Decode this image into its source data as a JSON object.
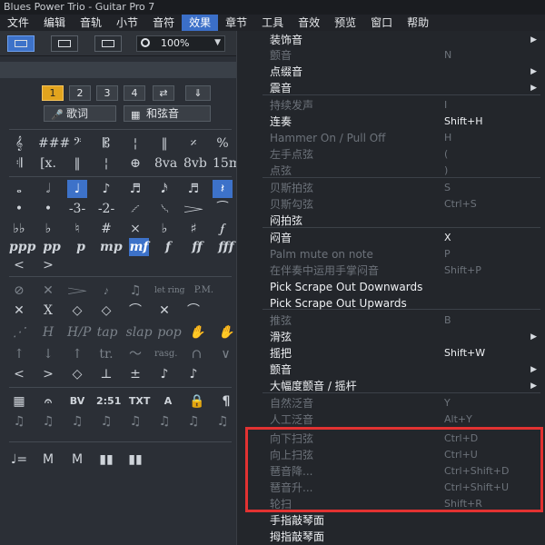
{
  "window": {
    "title": "Blues Power Trio - Guitar Pro 7"
  },
  "menubar": {
    "items": [
      "文件",
      "编辑",
      "音轨",
      "小节",
      "音符",
      "效果",
      "章节",
      "工具",
      "音效",
      "预览",
      "窗口",
      "帮助"
    ],
    "active_index": 5
  },
  "toolbar": {
    "zoom": "100%"
  },
  "palette": {
    "numbers": [
      "1",
      "2",
      "3",
      "4"
    ],
    "lyrics_label": "歌词",
    "chords_label": "和弦音",
    "row_clefs": [
      "𝄞",
      "###",
      "𝄢",
      "𝄡",
      "¦",
      "‖",
      "𝄎",
      "%",
      "2"
    ],
    "row_marks": [
      "𝄇",
      "[x.",
      "‖",
      "¦",
      "⊕",
      "8va",
      "8vb",
      "15ma",
      "15mb"
    ],
    "row_durations": [
      "𝅝",
      "𝅗𝅥",
      "♩",
      "♪",
      "♬",
      "𝅘𝅥𝅯",
      "♬",
      "𝄽"
    ],
    "row_tuplets": [
      "•",
      "•",
      "-3-",
      "-2-",
      "𝆱",
      "𝆲",
      "𝆓",
      "⁀"
    ],
    "row_accidentals": [
      "♭♭",
      "♭",
      "♮",
      "#",
      "×",
      "♭",
      "♯",
      "𝆑"
    ],
    "row_dynamics": [
      "ppp",
      "pp",
      "p",
      "mp",
      "mf",
      "f",
      "ff",
      "fff"
    ],
    "row_effects1": [
      "⊘",
      "✕",
      "𝆓",
      "𝆔",
      "♫",
      "let ring",
      "P.M."
    ],
    "row_effects2": [
      "✕",
      "X",
      "◇",
      "◇",
      "⌒",
      "✕",
      "⌒"
    ],
    "row_effects3": [
      "⋰",
      "H",
      "H/P",
      "tap",
      "slap",
      "pop",
      "✋",
      "✋"
    ],
    "row_effects4": [
      "↑",
      "↓",
      "↑",
      "tr.",
      "～",
      "rasg.",
      "∩",
      "∨"
    ],
    "row_effects5": [
      "<",
      ">",
      "◇",
      "⊥",
      "±",
      "♪",
      "♪"
    ],
    "row_misc1": [
      "▦",
      "𝄐",
      "BV",
      "2:51",
      "TXT",
      "A",
      "🔒",
      "¶"
    ],
    "row_misc2": [
      "♫",
      "♫",
      "♫",
      "♫",
      "♫",
      "♫",
      "♫",
      "♫"
    ],
    "row_misc3": [
      "♩=",
      "M",
      "M",
      "▮▮",
      "▮▮"
    ]
  },
  "menu": {
    "items": [
      {
        "label": "装饰音",
        "shortcut": "",
        "submenu": true,
        "disabled": false
      },
      {
        "label": "颤音",
        "shortcut": "N",
        "submenu": false,
        "disabled": true
      },
      {
        "label": "点缀音",
        "shortcut": "",
        "submenu": true,
        "disabled": false
      },
      {
        "label": "震音",
        "shortcut": "",
        "submenu": true,
        "disabled": false
      },
      {
        "label": "持续发声",
        "shortcut": "I",
        "submenu": false,
        "disabled": true
      },
      {
        "label": "连奏",
        "shortcut": "Shift+H",
        "submenu": false,
        "disabled": false
      },
      {
        "label": "Hammer On / Pull Off",
        "shortcut": "H",
        "submenu": false,
        "disabled": true
      },
      {
        "label": "左手点弦",
        "shortcut": "(",
        "submenu": false,
        "disabled": true
      },
      {
        "label": "点弦",
        "shortcut": ")",
        "submenu": false,
        "disabled": true
      },
      {
        "label": "贝斯拍弦",
        "shortcut": "S",
        "submenu": false,
        "disabled": true
      },
      {
        "label": "贝斯勾弦",
        "shortcut": "Ctrl+S",
        "submenu": false,
        "disabled": true
      },
      {
        "label": "闷拍弦",
        "shortcut": "",
        "submenu": false,
        "disabled": false
      },
      {
        "label": "闷音",
        "shortcut": "X",
        "submenu": false,
        "disabled": false
      },
      {
        "label": "Palm mute on note",
        "shortcut": "P",
        "submenu": false,
        "disabled": true
      },
      {
        "label": "在伴奏中运用手掌闷音",
        "shortcut": "Shift+P",
        "submenu": false,
        "disabled": true
      },
      {
        "label": "Pick Scrape Out Downwards",
        "shortcut": "",
        "submenu": false,
        "disabled": false
      },
      {
        "label": "Pick Scrape Out Upwards",
        "shortcut": "",
        "submenu": false,
        "disabled": false
      },
      {
        "label": "推弦",
        "shortcut": "B",
        "submenu": false,
        "disabled": true
      },
      {
        "label": "滑弦",
        "shortcut": "",
        "submenu": true,
        "disabled": false
      },
      {
        "label": "摇把",
        "shortcut": "Shift+W",
        "submenu": false,
        "disabled": false
      },
      {
        "label": "颤音",
        "shortcut": "",
        "submenu": true,
        "disabled": false
      },
      {
        "label": "大幅度颤音 / 摇杆",
        "shortcut": "",
        "submenu": true,
        "disabled": false
      },
      {
        "label": "自然泛音",
        "shortcut": "Y",
        "submenu": false,
        "disabled": true
      },
      {
        "label": "人工泛音",
        "shortcut": "Alt+Y",
        "submenu": false,
        "disabled": true
      },
      {
        "label": "向下扫弦",
        "shortcut": "Ctrl+D",
        "submenu": false,
        "disabled": true
      },
      {
        "label": "向上扫弦",
        "shortcut": "Ctrl+U",
        "submenu": false,
        "disabled": true
      },
      {
        "label": "琶音降...",
        "shortcut": "Ctrl+Shift+D",
        "submenu": false,
        "disabled": true
      },
      {
        "label": "琶音升...",
        "shortcut": "Ctrl+Shift+U",
        "submenu": false,
        "disabled": true
      },
      {
        "label": "轮扫",
        "shortcut": "Shift+R",
        "submenu": false,
        "disabled": true
      },
      {
        "label": "手指敲琴面",
        "shortcut": "",
        "submenu": false,
        "disabled": false
      },
      {
        "label": "拇指敲琴面",
        "shortcut": "",
        "submenu": false,
        "disabled": false
      }
    ]
  },
  "colors": {
    "accent": "#3b6fc8",
    "highlight_box": "#e23232",
    "number_selected": "#e2a41e"
  }
}
